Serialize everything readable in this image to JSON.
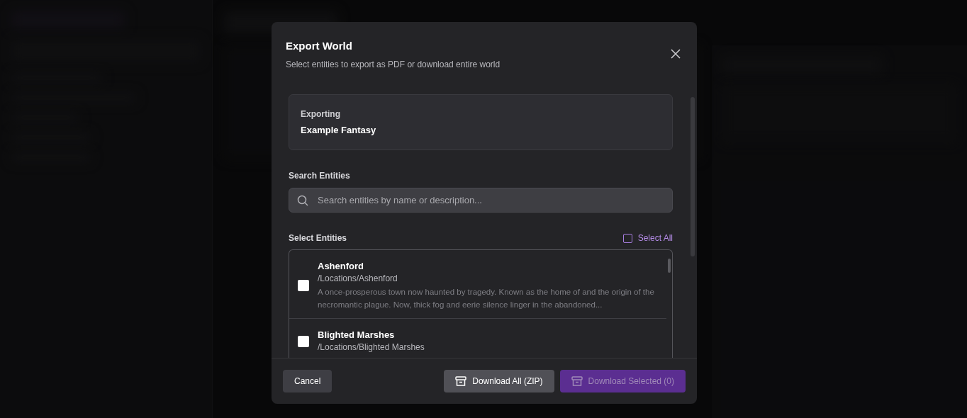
{
  "dialog": {
    "title": "Export World",
    "subtitle": "Select entities to export as PDF or download entire world",
    "exporting": {
      "label": "Exporting",
      "world": "Example Fantasy"
    },
    "search": {
      "label": "Search Entities",
      "placeholder": "Search entities by name or description..."
    },
    "select": {
      "label": "Select Entities",
      "select_all": {
        "label": "Select All",
        "checked": false
      }
    },
    "entities": [
      {
        "name": "Ashenford",
        "path": "/Locations/Ashenford",
        "description": "A once-prosperous town now haunted by tragedy. Known as the home of and the origin of the necromantic plague. Now, thick fog and eerie silence linger in the abandoned...",
        "checked": false
      },
      {
        "name": "Blighted Marshes",
        "path": "/Locations/Blighted Marshes",
        "checked": false
      }
    ],
    "buttons": [
      {
        "kind": "cancel",
        "label": "Cancel",
        "disabled": false
      },
      {
        "kind": "secondary",
        "label": "Download All (ZIP)",
        "disabled": false
      },
      {
        "kind": "primary",
        "label": "Download Selected (0)",
        "disabled": true
      }
    ]
  }
}
